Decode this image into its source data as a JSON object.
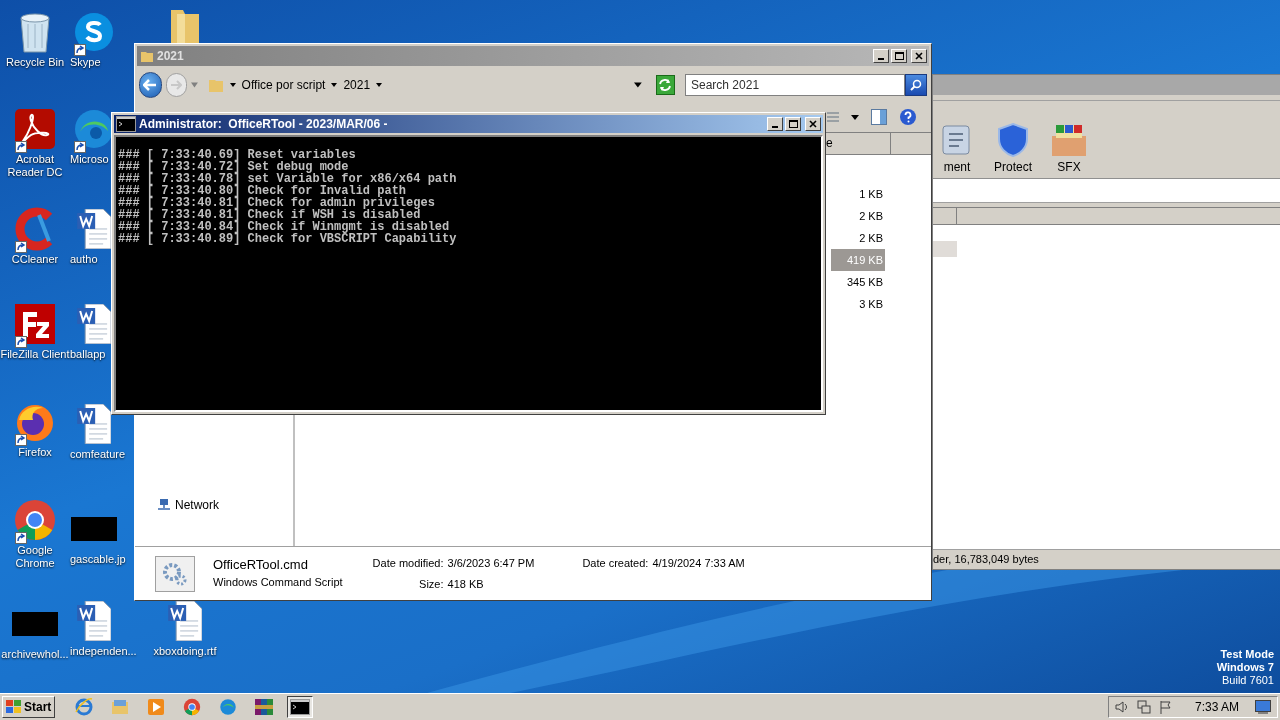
{
  "desktop_icons": [
    {
      "label": "Recycle Bin",
      "kind": "recycle-bin",
      "shortcut": false
    },
    {
      "label": "Acrobat Reader DC",
      "kind": "acrobat",
      "shortcut": true
    },
    {
      "label": "CCleaner",
      "kind": "ccleaner",
      "shortcut": true
    },
    {
      "label": "FileZilla Client",
      "kind": "filezilla",
      "shortcut": true
    },
    {
      "label": "Firefox",
      "kind": "firefox",
      "shortcut": true
    },
    {
      "label": "Google Chrome",
      "kind": "chrome",
      "shortcut": true
    },
    {
      "label": "archivewhol...",
      "kind": "redacted",
      "shortcut": false
    },
    {
      "label": "Skype",
      "kind": "skype",
      "shortcut": true
    },
    {
      "label": "Microso",
      "kind": "edge",
      "shortcut": true
    },
    {
      "label": "autho",
      "kind": "word",
      "shortcut": false
    },
    {
      "label": "ballapp",
      "kind": "word",
      "shortcut": false
    },
    {
      "label": "comfeature",
      "kind": "word",
      "shortcut": false
    },
    {
      "label": "gascable.jp",
      "kind": "redacted",
      "shortcut": false
    },
    {
      "label": "independen...",
      "kind": "word",
      "shortcut": false
    },
    {
      "kind": "folder",
      "shortcut": false
    },
    {
      "label": "xboxdoing.rtf",
      "kind": "word",
      "shortcut": false
    }
  ],
  "test_mode": [
    "Test Mode",
    "Windows 7",
    "Build 7601"
  ],
  "archiver_window": {
    "toolbar": [
      {
        "label": "ment",
        "kind": "document"
      },
      {
        "label": "Protect",
        "kind": "shield"
      },
      {
        "label": "SFX",
        "kind": "box"
      }
    ],
    "status_bar": "der, 16,783,049 bytes"
  },
  "explorer": {
    "title": "2021",
    "breadcrumbs": [
      "Office por script",
      "2021"
    ],
    "search": {
      "placeholder": "Search 2021"
    },
    "column_header_fragment": "e",
    "rows": [
      {
        "size": "1 KB",
        "selected": false
      },
      {
        "size": "2 KB",
        "selected": false
      },
      {
        "size": "2 KB",
        "selected": false
      },
      {
        "size": "419 KB",
        "selected": true
      },
      {
        "size": "345 KB",
        "selected": false
      },
      {
        "size": "3 KB",
        "selected": false
      }
    ],
    "nav_items": [
      {
        "label": "Network"
      }
    ],
    "details": {
      "name": "OfficeRTool.cmd",
      "type": "Windows Command Script",
      "fields": [
        {
          "label": "Date modified:",
          "value": "3/6/2023 6:47 PM"
        },
        {
          "label": "Size:",
          "value": "418 KB"
        },
        {
          "label": "Date created:",
          "value": "4/19/2024 7:33 AM"
        }
      ]
    }
  },
  "console": {
    "title": "Administrator:  OfficeRTool - 2023/MAR/06 -",
    "lines": [
      "### [ 7:33:40.69] Reset variables",
      "### [ 7:33:40.72] Set debug mode",
      "### [ 7:33:40.78] set Variable for x86/x64 path",
      "### [ 7:33:40.80] Check for Invalid path",
      "### [ 7:33:40.81] Check for admin privileges",
      "### [ 7:33:40.81] Check if WSH is disabled",
      "### [ 7:33:40.84] Check if Winmgmt is disabled",
      "### [ 7:33:40.89] Check for VBSCRIPT Capability"
    ]
  },
  "taskbar": {
    "start": "Start",
    "apps": [
      {
        "kind": "ie",
        "active": false
      },
      {
        "kind": "explorer",
        "active": false
      },
      {
        "kind": "media",
        "active": false
      },
      {
        "kind": "chrome",
        "active": false
      },
      {
        "kind": "edge",
        "active": false
      },
      {
        "kind": "winrar",
        "active": false
      },
      {
        "kind": "cmd",
        "active": true
      }
    ],
    "clock": "7:33 AM"
  }
}
